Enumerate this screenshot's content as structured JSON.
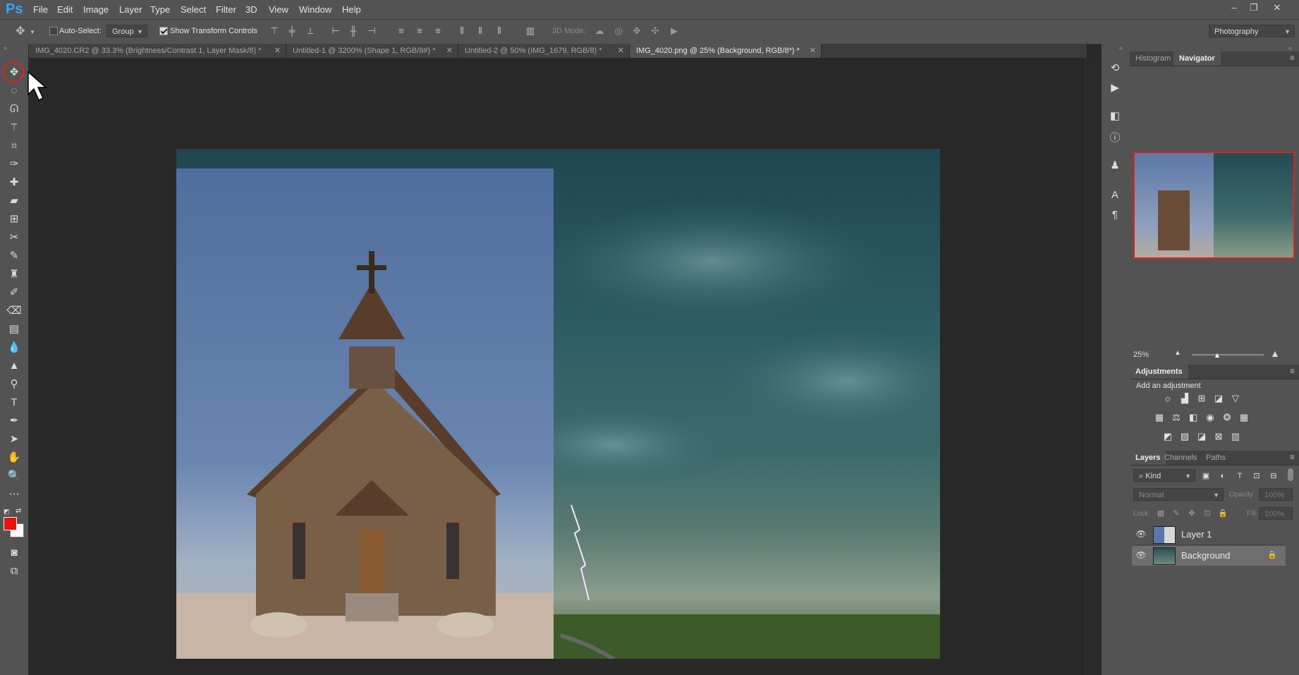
{
  "app": {
    "logo": "Ps"
  },
  "menu": [
    "File",
    "Edit",
    "Image",
    "Layer",
    "Type",
    "Select",
    "Filter",
    "3D",
    "View",
    "Window",
    "Help"
  ],
  "window_controls": {
    "minimize": "–",
    "restore": "❐",
    "close": "✕"
  },
  "options": {
    "auto_select_label": "Auto-Select:",
    "auto_select_checked": false,
    "auto_select_target": "Group",
    "show_transform_label": "Show Transform Controls",
    "show_transform_checked": true,
    "mode_3d_label": "3D Mode:",
    "workspace": "Photography"
  },
  "tabs": [
    {
      "label": "IMG_4020.CR2 @ 33.3% (Brightness/Contrast 1, Layer Mask/8) *",
      "active": false
    },
    {
      "label": "Untitled-1 @ 3200% (Shape 1, RGB/8#) *",
      "active": false
    },
    {
      "label": "Untitled-2 @ 50% (IMG_1679, RGB/8) *",
      "active": false
    },
    {
      "label": "IMG_4020.png @ 25% (Background, RGB/8*) *",
      "active": true
    }
  ],
  "colors": {
    "foreground": "#e8120c",
    "background": "#ffffff",
    "highlight": "#e0211c"
  },
  "navigator": {
    "tabs": [
      "Histogram",
      "Navigator"
    ],
    "active": "Navigator",
    "zoom": "25%",
    "zoom_level_fraction": 0.25
  },
  "adjustments": {
    "title": "Adjustments",
    "hint": "Add an adjustment"
  },
  "layers_panel": {
    "tabs": [
      "Layers",
      "Channels",
      "Paths"
    ],
    "active": "Layers",
    "filter": "Kind",
    "blend_mode": "Normal",
    "opacity_label": "Opacity:",
    "opacity_value": "100%",
    "lock_label": "Lock:",
    "fill_label": "Fill:",
    "fill_value": "100%",
    "layers": [
      {
        "name": "Layer 1",
        "visible": true,
        "selected": false,
        "locked": false
      },
      {
        "name": "Background",
        "visible": true,
        "selected": true,
        "locked": true
      }
    ]
  }
}
